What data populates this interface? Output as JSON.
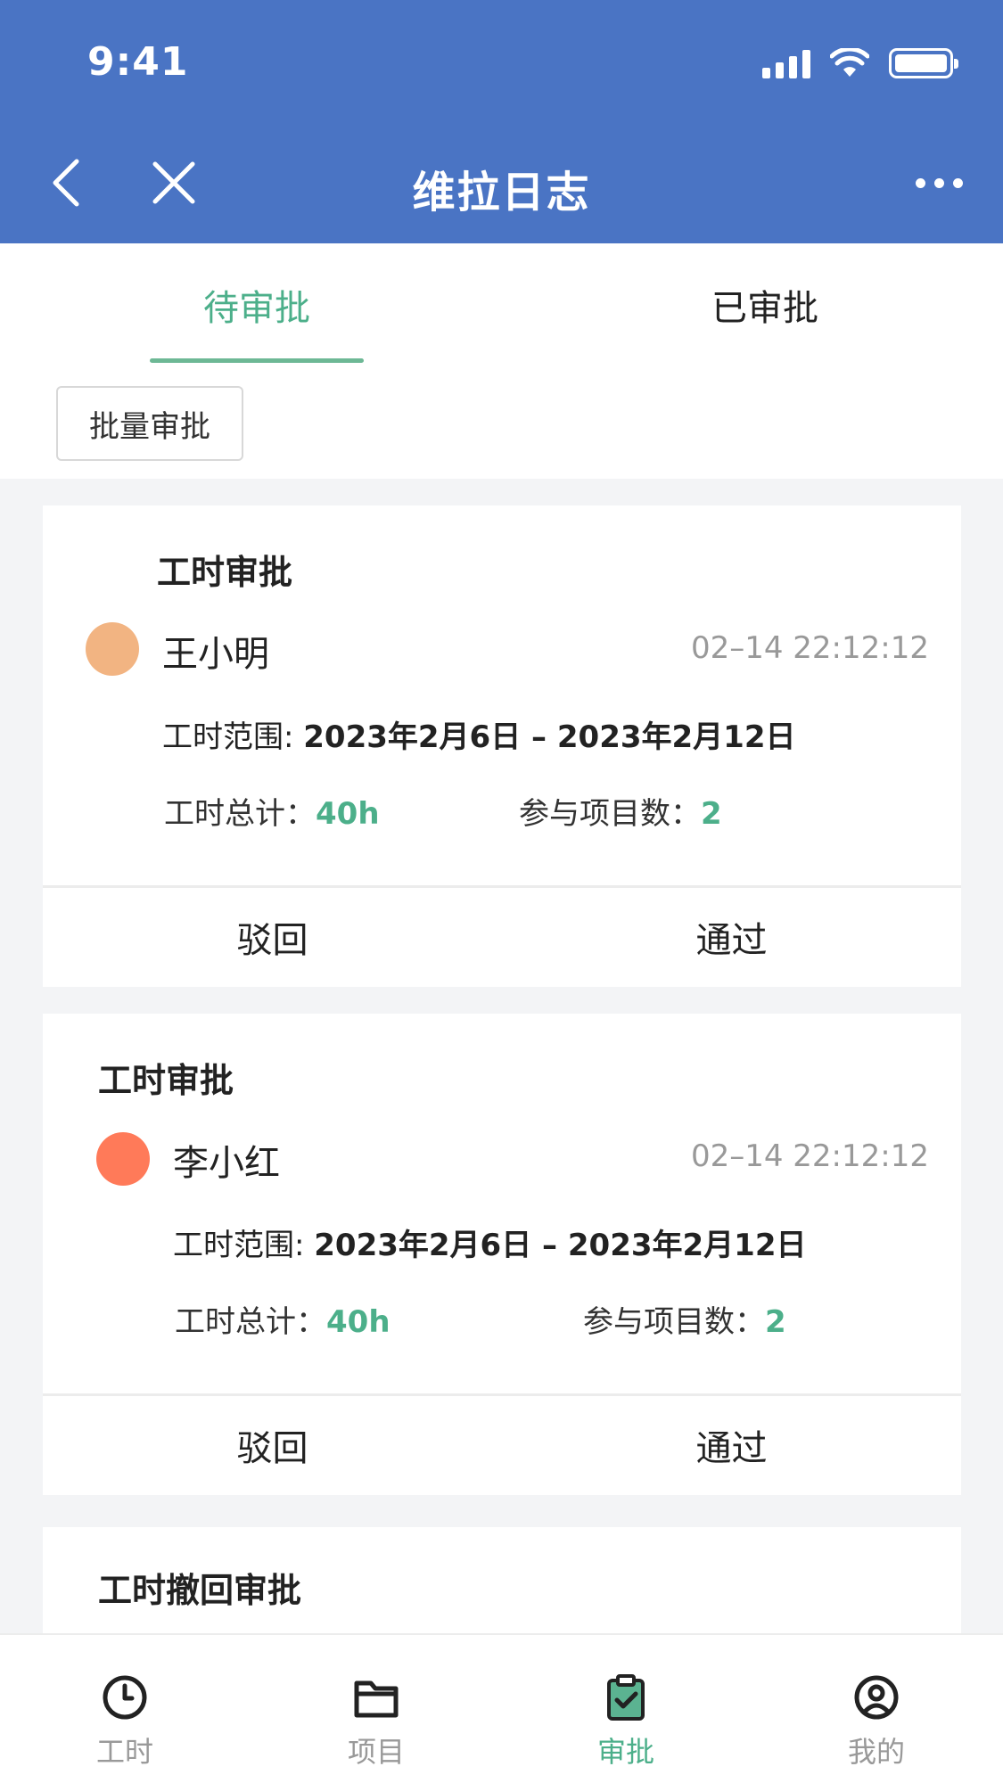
{
  "status_bar": {
    "time": "9:41"
  },
  "nav": {
    "title": "维拉日志"
  },
  "tabs": [
    {
      "label": "待审批",
      "active": true
    },
    {
      "label": "已审批",
      "active": false
    }
  ],
  "batch_button": "批量审批",
  "cards": [
    {
      "title": "工时审批",
      "person": "王小明",
      "avatar_color": "#f2b482",
      "time": "02–14 22:12:12",
      "range_label": "工时范围: ",
      "range_value": "2023年2月6日 – 2023年2月12日",
      "total_label": "工时总计：",
      "total_value": "40h",
      "projects_label": "参与项目数：",
      "projects_value": "2",
      "reject": "驳回",
      "approve": "通过"
    },
    {
      "title": "工时审批",
      "person": "李小红",
      "avatar_color": "#ff7a59",
      "time": "02–14 22:12:12",
      "range_label": "工时范围: ",
      "range_value": "2023年2月6日 – 2023年2月12日",
      "total_label": "工时总计：",
      "total_value": "40h",
      "projects_label": "参与项目数：",
      "projects_value": "2",
      "reject": "驳回",
      "approve": "通过"
    },
    {
      "title": "工时撤回审批"
    }
  ],
  "bottom_nav": [
    {
      "label": "工时",
      "icon": "clock-icon",
      "active": false
    },
    {
      "label": "项目",
      "icon": "folder-icon",
      "active": false
    },
    {
      "label": "审批",
      "icon": "clipboard-check-icon",
      "active": true
    },
    {
      "label": "我的",
      "icon": "user-circle-icon",
      "active": false
    }
  ],
  "colors": {
    "header_bg": "#4a74c4",
    "accent_green": "#4caf8a",
    "page_bg": "#f3f4f6"
  }
}
